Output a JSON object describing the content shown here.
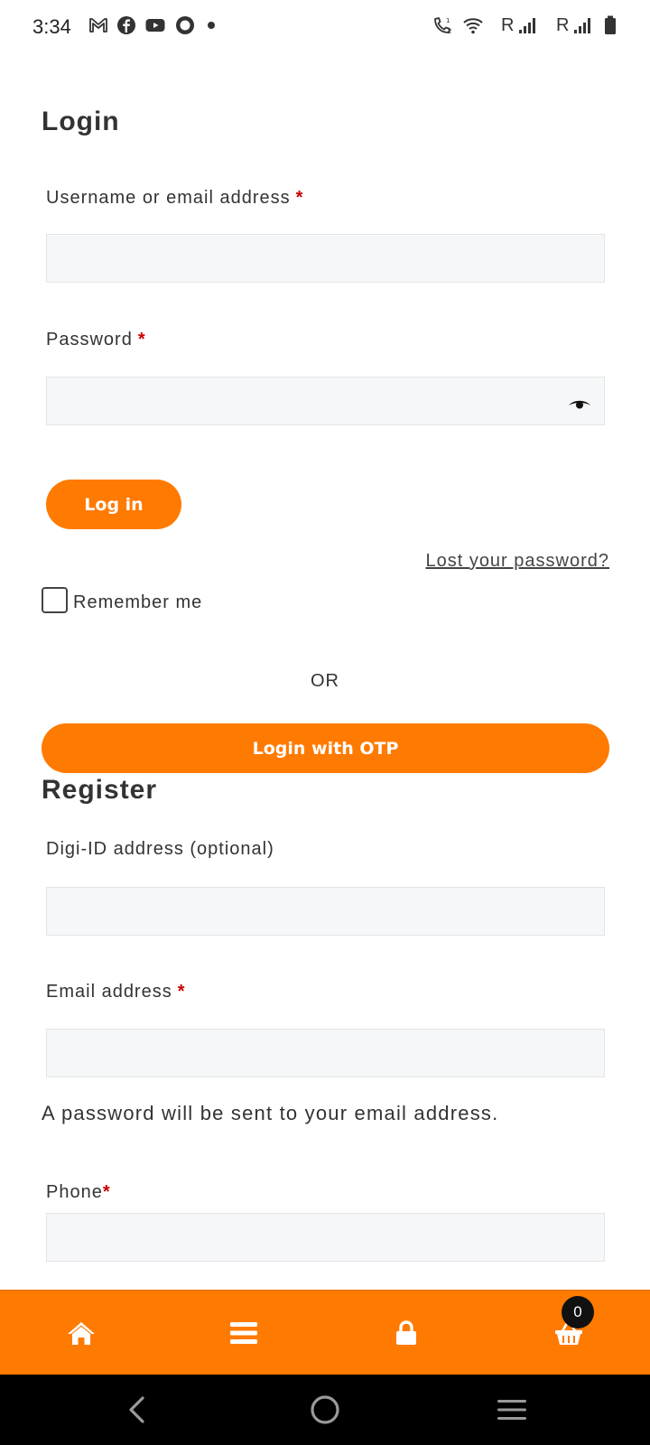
{
  "status_bar": {
    "time": "3:34",
    "left_icons": [
      "gmail-icon",
      "facebook-icon",
      "youtube-icon",
      "circle-app-icon",
      "dot-icon"
    ],
    "right_icons": [
      "wifi-call-icon",
      "wifi-icon",
      "signal-icon",
      "signal-icon",
      "battery-icon"
    ],
    "roaming_label_1": "R",
    "roaming_label_2": "R"
  },
  "login": {
    "title": "Login",
    "username_label": "Username or email address",
    "password_label": "Password",
    "required_mark": "*",
    "login_button": "Log in",
    "lost_password": "Lost your password?",
    "remember_me": "Remember me",
    "or_text": "OR",
    "otp_button": "Login with OTP"
  },
  "register": {
    "title": "Register",
    "digi_id_label": "Digi-ID address (optional)",
    "email_label": "Email address",
    "required_mark": "*",
    "password_info": "A password will be sent to your email address.",
    "phone_label": "Phone"
  },
  "bottom_nav": {
    "items": [
      "home-icon",
      "menu-icon",
      "lock-icon",
      "basket-icon"
    ],
    "cart_count": "0",
    "accent_color": "#ff7a00"
  },
  "system_nav": {
    "items": [
      "back-icon",
      "home-circle-icon",
      "recents-icon"
    ]
  }
}
